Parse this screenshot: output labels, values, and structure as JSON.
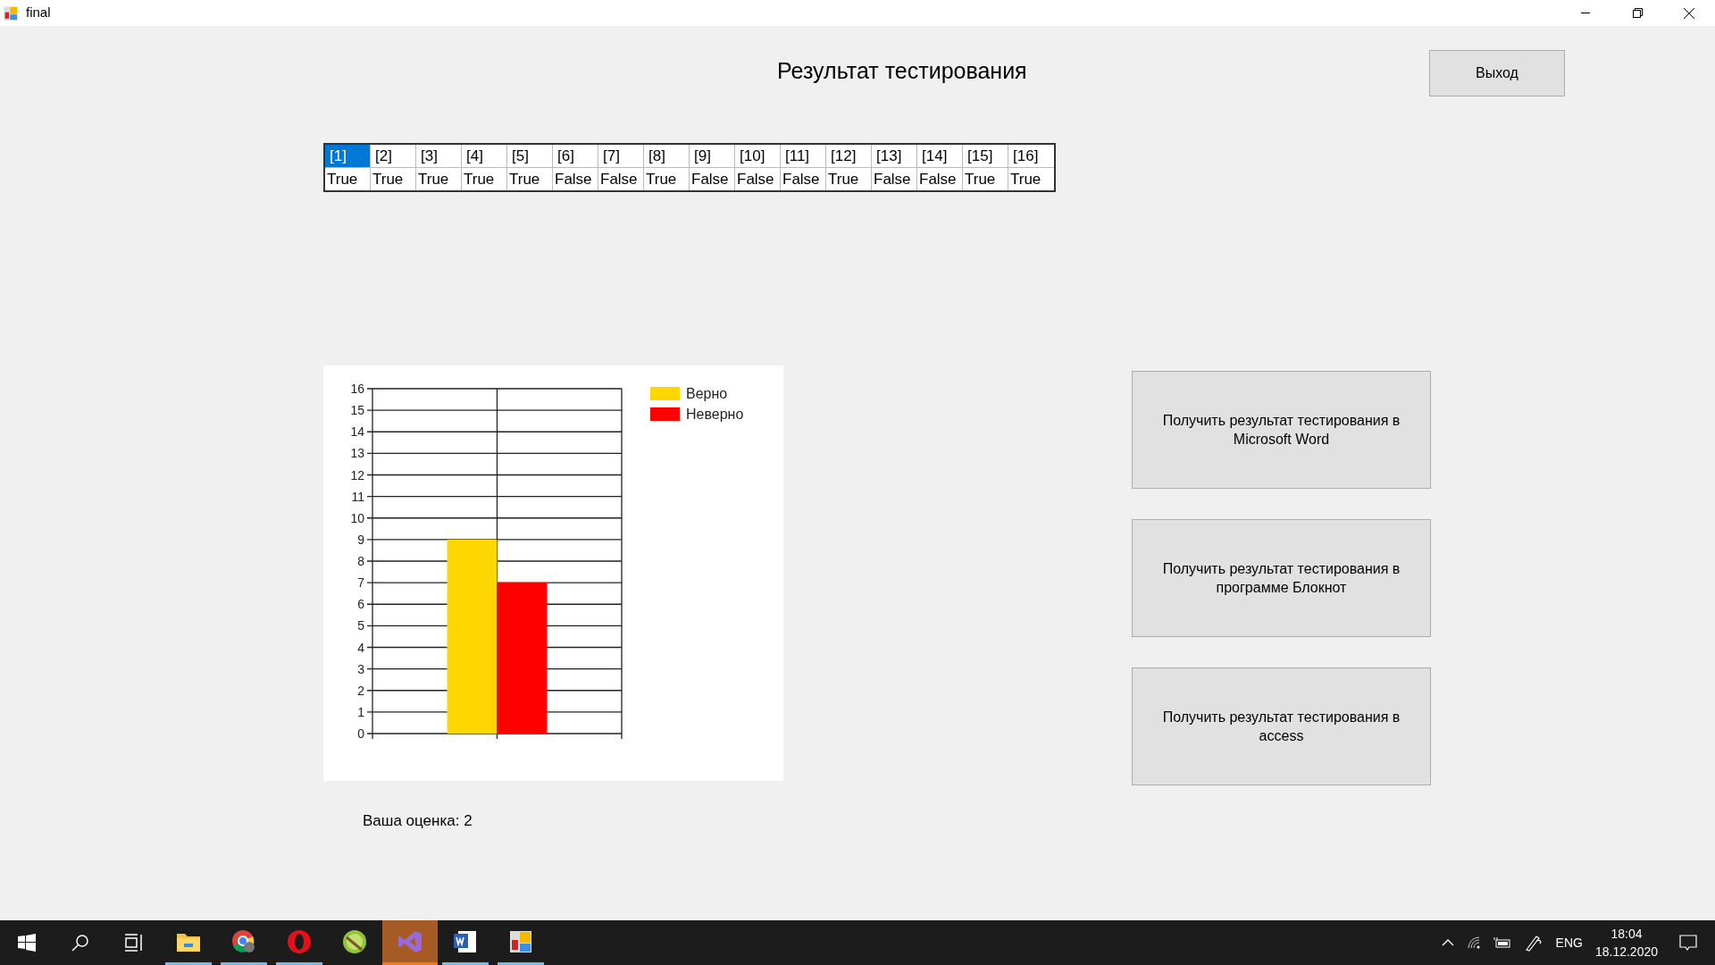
{
  "window": {
    "title": "final"
  },
  "heading": "Результат тестирования",
  "exit_button": "Выход",
  "answers_table": {
    "columns": [
      {
        "header": "[1]",
        "value": "True",
        "selected": true
      },
      {
        "header": "[2]",
        "value": "True",
        "selected": false
      },
      {
        "header": "[3]",
        "value": "True",
        "selected": false
      },
      {
        "header": "[4]",
        "value": "True",
        "selected": false
      },
      {
        "header": "[5]",
        "value": "True",
        "selected": false
      },
      {
        "header": "[6]",
        "value": "False",
        "selected": false
      },
      {
        "header": "[7]",
        "value": "False",
        "selected": false
      },
      {
        "header": "[8]",
        "value": "True",
        "selected": false
      },
      {
        "header": "[9]",
        "value": "False",
        "selected": false
      },
      {
        "header": "[10]",
        "value": "False",
        "selected": false
      },
      {
        "header": "[11]",
        "value": "False",
        "selected": false
      },
      {
        "header": "[12]",
        "value": "True",
        "selected": false
      },
      {
        "header": "[13]",
        "value": "False",
        "selected": false
      },
      {
        "header": "[14]",
        "value": "False",
        "selected": false
      },
      {
        "header": "[15]",
        "value": "True",
        "selected": false
      },
      {
        "header": "[16]",
        "value": "True",
        "selected": false
      }
    ]
  },
  "result_chart": {
    "chart_data": {
      "type": "bar",
      "grid": true,
      "legend": true,
      "ylim": [
        0,
        16
      ],
      "yticks": [
        0,
        1,
        2,
        3,
        4,
        5,
        6,
        7,
        8,
        9,
        10,
        11,
        12,
        13,
        14,
        15,
        16
      ],
      "series": [
        {
          "name": "Верно",
          "color": "#ffd700",
          "values": [
            9
          ]
        },
        {
          "name": "Неверно",
          "color": "#ff0000",
          "values": [
            7
          ]
        }
      ]
    }
  },
  "score": "Ваша оценка: 2",
  "export_buttons": [
    "Получить результат тестирования в Microsoft Word",
    "Получить результат тестирования в программе Блокнот",
    "Получить результат тестирования в access"
  ],
  "taskbar": {
    "apps": [
      {
        "kind": "folder",
        "running": true,
        "selected": false
      },
      {
        "kind": "chrome",
        "running": true,
        "selected": false
      },
      {
        "kind": "opera",
        "running": true,
        "selected": false
      },
      {
        "kind": "lime",
        "running": false,
        "selected": false
      },
      {
        "kind": "studio",
        "running": true,
        "selected": true
      },
      {
        "kind": "word",
        "running": true,
        "selected": false
      },
      {
        "kind": "app",
        "running": true,
        "selected": false
      }
    ],
    "language": "ENG",
    "time": "18:04",
    "date": "18.12.2020"
  }
}
